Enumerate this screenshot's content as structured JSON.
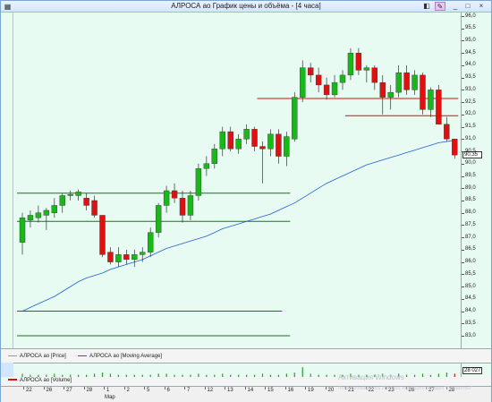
{
  "window": {
    "title": "АЛРОСА ао График цены и объёма - [4 часа]",
    "icon_name": "chart-app-icon",
    "controls": {
      "pin": "pin-icon",
      "pen": "pen-icon",
      "minimize": "_",
      "maximize": "□",
      "close": "×"
    }
  },
  "price_axis": {
    "labels": [
      "96,0",
      "95,5",
      "95,0",
      "94,5",
      "94,0",
      "93,5",
      "93,0",
      "92,5",
      "92,0",
      "91,5",
      "91,0",
      "90,5",
      "90,0",
      "89,5",
      "89,0",
      "88,5",
      "88,0",
      "87,5",
      "87,0",
      "86,5",
      "86,0",
      "85,5",
      "85,0",
      "84,5",
      "84,0",
      "83,5",
      "83,0"
    ],
    "last_price": "90,35"
  },
  "legend": {
    "price": "АЛРОСА ао [Price]",
    "ma": "АЛРОСА ао [Moving Average]"
  },
  "volume": {
    "legend": "АЛРОСА ао [Volume]",
    "last_value": "28 027"
  },
  "x_axis": {
    "labels": [
      "22",
      "26",
      "27",
      "28",
      "1",
      "2",
      "5",
      "6",
      "7",
      "12",
      "13",
      "14",
      "15",
      "16",
      "19",
      "20",
      "21",
      "22",
      "23",
      "26",
      "27",
      "28"
    ],
    "month": "Мар"
  },
  "watermark": {
    "line1": "Активация Windows",
    "line2": "Чтобы активировать Windows, перейдите в раздел \"Параметры\""
  },
  "colors": {
    "up": "#18b818",
    "down": "#e01010",
    "ma": "#1f5fd8",
    "support": "#127a12",
    "resistance": "#d01010",
    "plot_bg": "#e8fbf2"
  },
  "chart_data": {
    "type": "candlestick",
    "ylim": [
      83.0,
      96.0
    ],
    "candles": [
      {
        "o": 86.8,
        "h": 88.0,
        "l": 86.3,
        "c": 87.8
      },
      {
        "o": 87.7,
        "h": 88.1,
        "l": 87.4,
        "c": 87.9
      },
      {
        "o": 87.8,
        "h": 88.3,
        "l": 87.6,
        "c": 88.0
      },
      {
        "o": 87.9,
        "h": 88.2,
        "l": 87.3,
        "c": 88.1
      },
      {
        "o": 88.0,
        "h": 88.6,
        "l": 87.8,
        "c": 88.3
      },
      {
        "o": 88.3,
        "h": 88.8,
        "l": 88.0,
        "c": 88.7
      },
      {
        "o": 88.7,
        "h": 88.9,
        "l": 88.5,
        "c": 88.75
      },
      {
        "o": 88.7,
        "h": 88.95,
        "l": 88.5,
        "c": 88.85
      },
      {
        "o": 88.6,
        "h": 88.8,
        "l": 88.1,
        "c": 88.3
      },
      {
        "o": 88.5,
        "h": 88.7,
        "l": 87.8,
        "c": 87.9
      },
      {
        "o": 87.9,
        "h": 87.9,
        "l": 86.2,
        "c": 86.3
      },
      {
        "o": 86.4,
        "h": 86.6,
        "l": 85.9,
        "c": 86.0
      },
      {
        "o": 86.0,
        "h": 86.6,
        "l": 85.8,
        "c": 86.3
      },
      {
        "o": 86.3,
        "h": 86.5,
        "l": 85.9,
        "c": 86.1
      },
      {
        "o": 86.1,
        "h": 86.5,
        "l": 85.8,
        "c": 86.3
      },
      {
        "o": 86.3,
        "h": 86.6,
        "l": 86.0,
        "c": 86.4
      },
      {
        "o": 86.4,
        "h": 87.4,
        "l": 86.2,
        "c": 87.2
      },
      {
        "o": 87.2,
        "h": 88.4,
        "l": 87.0,
        "c": 88.3
      },
      {
        "o": 88.3,
        "h": 89.1,
        "l": 88.0,
        "c": 88.9
      },
      {
        "o": 88.9,
        "h": 89.2,
        "l": 88.4,
        "c": 88.6
      },
      {
        "o": 88.6,
        "h": 88.9,
        "l": 87.6,
        "c": 87.9
      },
      {
        "o": 87.9,
        "h": 88.9,
        "l": 87.7,
        "c": 88.7
      },
      {
        "o": 88.7,
        "h": 90.0,
        "l": 88.5,
        "c": 89.8
      },
      {
        "o": 89.8,
        "h": 90.3,
        "l": 89.5,
        "c": 90.0
      },
      {
        "o": 90.0,
        "h": 90.8,
        "l": 89.8,
        "c": 90.6
      },
      {
        "o": 90.6,
        "h": 91.5,
        "l": 90.3,
        "c": 91.3
      },
      {
        "o": 91.3,
        "h": 91.5,
        "l": 90.5,
        "c": 90.6
      },
      {
        "o": 90.6,
        "h": 91.2,
        "l": 90.4,
        "c": 91.0
      },
      {
        "o": 91.0,
        "h": 91.6,
        "l": 90.8,
        "c": 91.4
      },
      {
        "o": 91.4,
        "h": 91.5,
        "l": 90.5,
        "c": 90.7
      },
      {
        "o": 90.7,
        "h": 90.9,
        "l": 89.2,
        "c": 90.6
      },
      {
        "o": 90.6,
        "h": 91.4,
        "l": 90.3,
        "c": 91.2
      },
      {
        "o": 91.2,
        "h": 91.4,
        "l": 90.0,
        "c": 90.3
      },
      {
        "o": 90.3,
        "h": 91.3,
        "l": 89.9,
        "c": 91.1
      },
      {
        "o": 91.0,
        "h": 92.9,
        "l": 90.9,
        "c": 92.7
      },
      {
        "o": 92.7,
        "h": 94.2,
        "l": 92.5,
        "c": 93.9
      },
      {
        "o": 93.9,
        "h": 94.1,
        "l": 93.3,
        "c": 93.6
      },
      {
        "o": 93.6,
        "h": 93.9,
        "l": 92.9,
        "c": 93.2
      },
      {
        "o": 93.2,
        "h": 93.5,
        "l": 92.6,
        "c": 92.8
      },
      {
        "o": 92.8,
        "h": 93.6,
        "l": 92.7,
        "c": 93.3
      },
      {
        "o": 93.3,
        "h": 93.8,
        "l": 93.0,
        "c": 93.6
      },
      {
        "o": 93.6,
        "h": 94.7,
        "l": 93.4,
        "c": 94.5
      },
      {
        "o": 94.5,
        "h": 94.7,
        "l": 93.6,
        "c": 93.8
      },
      {
        "o": 93.8,
        "h": 94.0,
        "l": 93.3,
        "c": 93.9
      },
      {
        "o": 93.9,
        "h": 94.0,
        "l": 93.0,
        "c": 93.3
      },
      {
        "o": 93.3,
        "h": 93.6,
        "l": 92.0,
        "c": 92.7
      },
      {
        "o": 92.7,
        "h": 93.2,
        "l": 92.2,
        "c": 92.9
      },
      {
        "o": 92.9,
        "h": 94.0,
        "l": 92.7,
        "c": 93.7
      },
      {
        "o": 93.7,
        "h": 94.0,
        "l": 92.8,
        "c": 93.0
      },
      {
        "o": 93.0,
        "h": 93.8,
        "l": 92.8,
        "c": 93.6
      },
      {
        "o": 93.6,
        "h": 93.7,
        "l": 92.0,
        "c": 92.2
      },
      {
        "o": 92.2,
        "h": 93.1,
        "l": 91.9,
        "c": 93.0
      },
      {
        "o": 93.0,
        "h": 93.2,
        "l": 91.8,
        "c": 91.6
      },
      {
        "o": 91.6,
        "h": 91.9,
        "l": 90.9,
        "c": 91.0
      },
      {
        "o": 91.0,
        "h": 91.0,
        "l": 90.2,
        "c": 90.35
      }
    ],
    "moving_average": [
      84.0,
      84.15,
      84.3,
      84.45,
      84.6,
      84.8,
      85.0,
      85.2,
      85.35,
      85.45,
      85.55,
      85.7,
      85.8,
      85.9,
      86.0,
      86.1,
      86.25,
      86.4,
      86.55,
      86.65,
      86.75,
      86.85,
      86.95,
      87.05,
      87.2,
      87.35,
      87.45,
      87.55,
      87.65,
      87.75,
      87.85,
      87.95,
      88.1,
      88.25,
      88.4,
      88.6,
      88.8,
      89.0,
      89.2,
      89.35,
      89.5,
      89.65,
      89.8,
      89.95,
      90.05,
      90.15,
      90.25,
      90.35,
      90.45,
      90.55,
      90.65,
      90.75,
      90.85,
      90.9,
      90.95
    ],
    "hlines": [
      {
        "y": 88.8,
        "x0": 0,
        "x1": 33,
        "kind": "support"
      },
      {
        "y": 87.65,
        "x0": 0,
        "x1": 33,
        "kind": "support"
      },
      {
        "y": 84.0,
        "x0": 0,
        "x1": 32,
        "kind": "support"
      },
      {
        "y": 83.0,
        "x0": 0,
        "x1": 33,
        "kind": "support"
      },
      {
        "y": 92.65,
        "x0": 30,
        "x1": 54,
        "kind": "resistance"
      },
      {
        "y": 91.95,
        "x0": 41,
        "x1": 54,
        "kind": "resistance"
      }
    ],
    "volume_bars": [
      3,
      2,
      2,
      2,
      3,
      2,
      2,
      2,
      2,
      3,
      4,
      3,
      2,
      2,
      2,
      2,
      2,
      3,
      3,
      2,
      2,
      2,
      3,
      2,
      2,
      3,
      2,
      2,
      2,
      2,
      3,
      2,
      2,
      3,
      4,
      9,
      3,
      2,
      2,
      2,
      2,
      3,
      2,
      2,
      2,
      3,
      2,
      3,
      2,
      2,
      3,
      2,
      3,
      4,
      3
    ],
    "volume_highlight_index": 54
  }
}
